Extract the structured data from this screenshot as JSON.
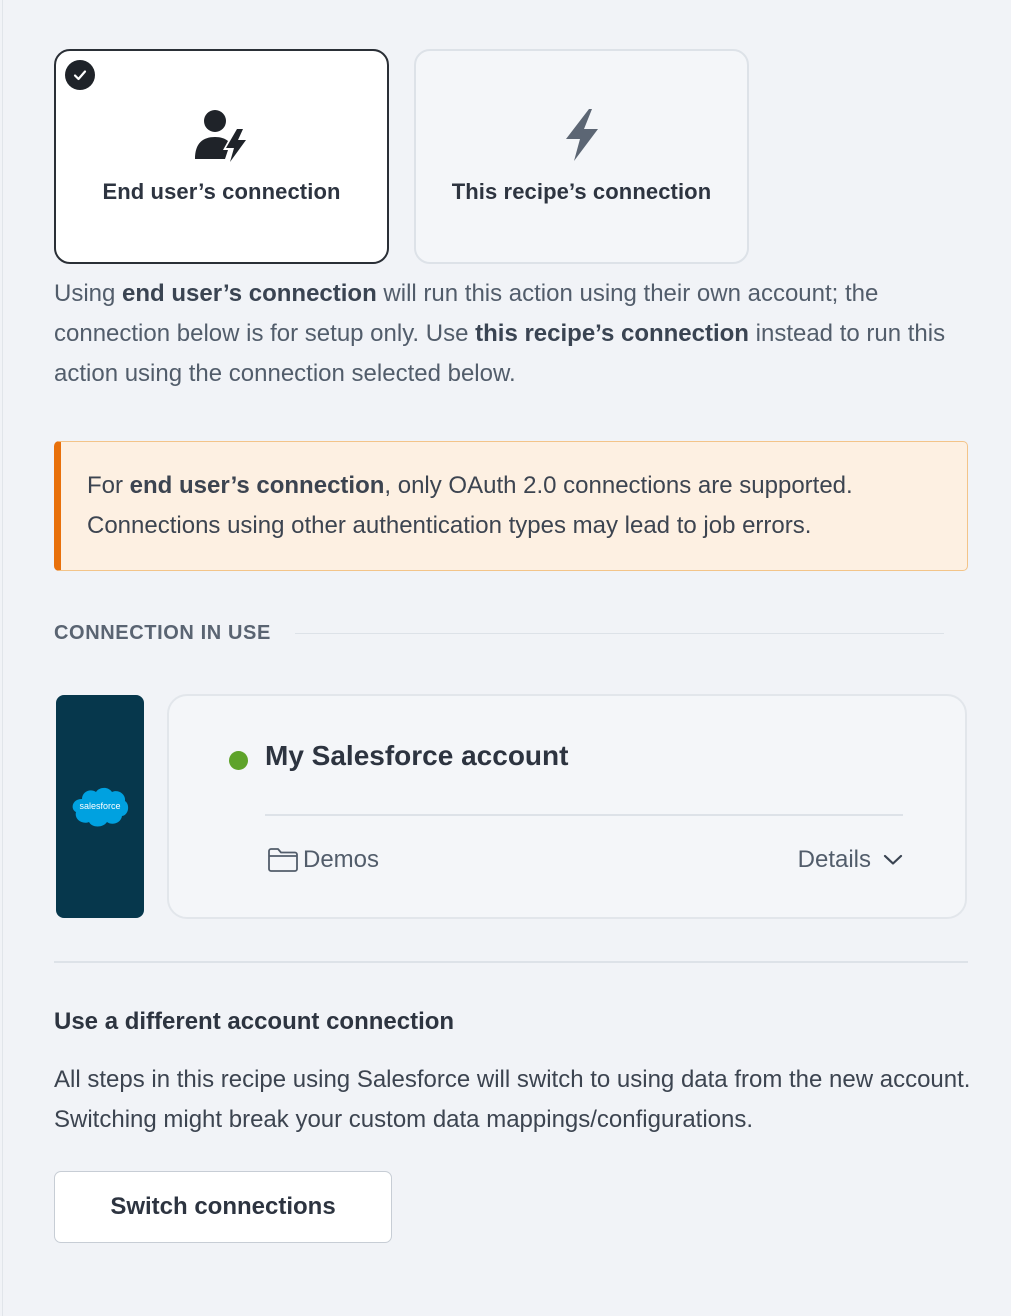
{
  "options": {
    "end_user": {
      "label": "End user’s connection",
      "selected": true,
      "icon": "user-bolt-icon"
    },
    "recipe": {
      "label": "This recipe’s connection",
      "selected": false,
      "icon": "bolt-icon"
    }
  },
  "description": {
    "p1": "Using ",
    "b1": "end user’s connection",
    "p2": " will run this action using their own account; the connection below is for setup only. Use ",
    "b2": "this recipe’s connection",
    "p3": " instead to run this action using the connection selected below."
  },
  "warning": {
    "p1": "For ",
    "b1": "end user’s connection",
    "p2": ", only OAuth 2.0 connections are supported. Connections using other authentication types may lead to job errors."
  },
  "section_title": "CONNECTION IN USE",
  "connection": {
    "logo_text": "salesforce",
    "name": "My Salesforce account",
    "status": "connected",
    "status_color": "#5ea32a",
    "folder": "Demos",
    "details_label": "Details"
  },
  "switch": {
    "title": "Use a different account connection",
    "description": "All steps in this recipe using Salesforce will switch to using data from the new account. Switching might break your custom data mappings/configurations.",
    "button_label": "Switch connections"
  },
  "colors": {
    "warning_accent": "#e8700b",
    "logo_bg": "#06374c",
    "salesforce_blue": "#00a1e0"
  }
}
